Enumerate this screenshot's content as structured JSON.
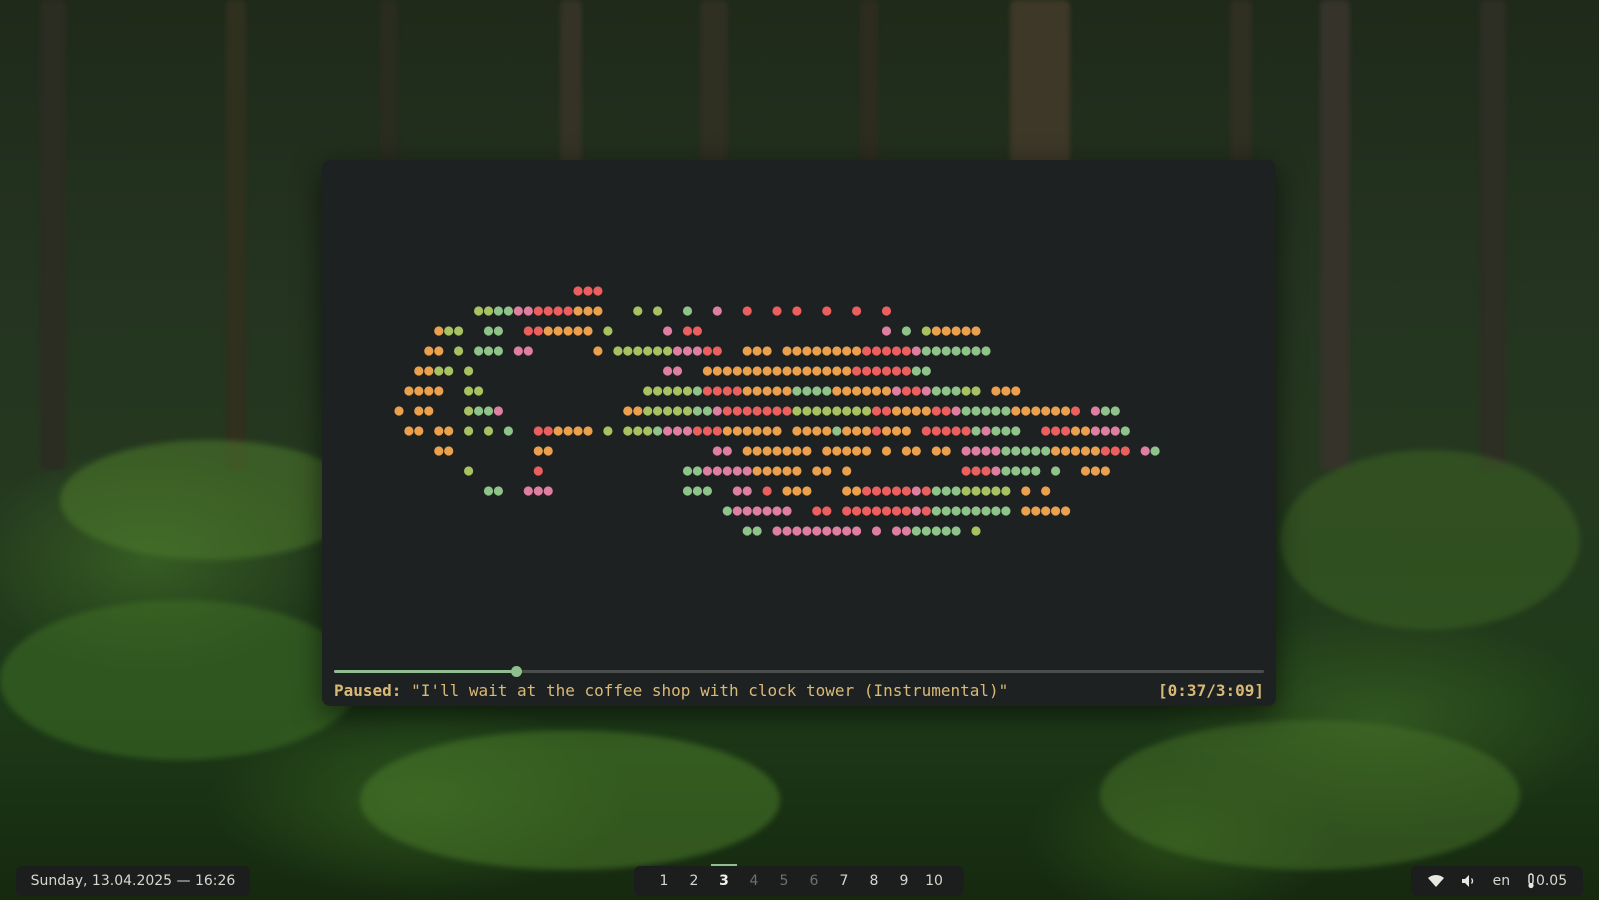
{
  "player": {
    "state_label": "Paused:",
    "track_title": "\"I'll wait at the coffee shop with clock tower (Instrumental)\"",
    "time_display": "[0:37/3:09]",
    "progress_fraction": 0.196
  },
  "visualizer": {
    "colors": {
      "o": "#eba04e",
      "g": "#a8c262",
      "s": "#8ec48a",
      "p": "#de7fa2",
      "r": "#ec5f5f",
      "y": "#cfc468"
    },
    "rows": [
      "                   rrr                                                      ",
      "         ggsspprrrrooo   g g  s  p  r  r r  r  r  r                          ",
      "     ogg  ss  rrooooo g     p rr                  p s gooooo                 ",
      "    oo g sss pp      o ggggggppprr  ooo oooooooorrrrrpsssssss                ",
      "   oogg g                   pp  ooooooooooooooorrrrrrss                      ",
      "  oooo  gg                gggggsrrrrooooossssooooooprrpsssgg ooo             ",
      " o oo   gssp            oogggggssprrrrrrrggggggggrroooorrpsssssoooooor pss   ",
      "  oo oo g g s  rroooo g gggsppprrroooooo oooosooorooo rrrrrspsss  rrrooppps  ",
      "     oo        oo                pp ooooooo ooooo o oo oo ppppsssssooooorrr ps  ",
      "        g      r              sspppppooooo oo o           rrrpssss s  ooo    ",
      "          ss  ppp             sss  pp r ooo   oorrrrrprsssggggg o o          ",
      "                                  spppppp  rr rrrrrrrprssssssss ooooo        ",
      "                                    ss ppppppppp p ppsssss g                 "
    ]
  },
  "taskbar": {
    "clock": "Sunday, 13.04.2025 — 16:26",
    "workspaces": [
      {
        "label": "1",
        "active": false,
        "empty": false
      },
      {
        "label": "2",
        "active": false,
        "empty": false
      },
      {
        "label": "3",
        "active": true,
        "empty": false
      },
      {
        "label": "4",
        "active": false,
        "empty": true
      },
      {
        "label": "5",
        "active": false,
        "empty": true
      },
      {
        "label": "6",
        "active": false,
        "empty": true
      },
      {
        "label": "7",
        "active": false,
        "empty": false
      },
      {
        "label": "8",
        "active": false,
        "empty": false
      },
      {
        "label": "9",
        "active": false,
        "empty": false
      },
      {
        "label": "10",
        "active": false,
        "empty": false
      }
    ],
    "tray": {
      "wifi_icon": "wifi-icon",
      "volume_icon": "volume-icon",
      "keyboard_layout": "en",
      "temp_icon": "thermometer-icon",
      "load_value": "0.05"
    }
  }
}
